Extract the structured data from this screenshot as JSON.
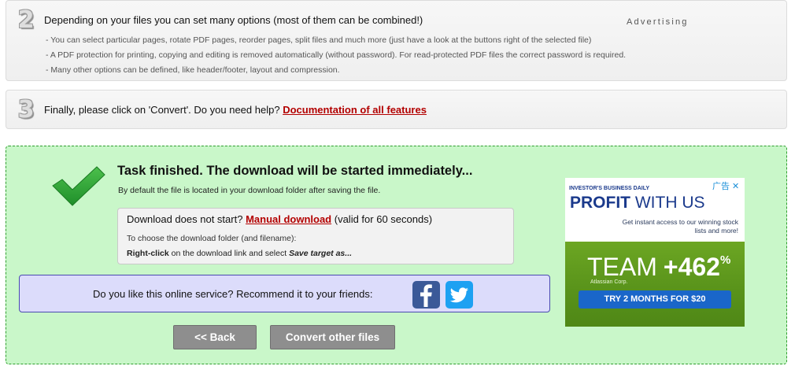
{
  "step2": {
    "number": "2",
    "title": "Depending on your files you can set many options (most of them can be combined!)",
    "notes": [
      "- You can select particular pages, rotate PDF pages, reorder pages, split files and much more (just have a look at the buttons right of the selected file)",
      "- A PDF protection for printing, copying and editing is removed automatically (without password). For read-protected PDF files the correct password is required.",
      "- Many other options can be defined, like header/footer, layout and compression."
    ]
  },
  "step3": {
    "number": "3",
    "text": "Finally, please click on 'Convert'. Do you need help?",
    "link": "Documentation of all features"
  },
  "result": {
    "title": "Task finished. The download will be started immediately...",
    "subtitle": "By default the file is located in your download folder after saving the file.",
    "download": {
      "prefix": "Download does not start?",
      "link": "Manual download",
      "suffix": "(valid for 60 seconds)",
      "hint": "To choose the download folder (and filename):",
      "instruction_bold": "Right-click",
      "instruction_mid": "on the download link and select",
      "instruction_italic": "Save target as..."
    },
    "share": {
      "text": "Do you like this online service? Recommend it to your friends:",
      "facebook_icon": "facebook-icon",
      "twitter_icon": "twitter-icon"
    },
    "buttons": {
      "back": "<< Back",
      "convert_other": "Convert other files"
    }
  },
  "ad": {
    "label": "Advertising",
    "publisher": "INVESTOR'S BUSINESS DAILY",
    "close": "广告 ✕",
    "headline_bold": "PROFIT",
    "headline_rest": "WITH US",
    "body": "Get instant access to our winning stock lists and more!",
    "team": "TEAM",
    "percent": "+462",
    "percent_sign": "%",
    "company": "Atlassian Corp.",
    "cta": "TRY 2 MONTHS FOR $20"
  },
  "colors": {
    "result_bg": "#c9f7c9",
    "result_border": "#2f9e2f",
    "link": "#b30000",
    "share_bg": "#dcdcfb",
    "button_bg": "#8e8e8e",
    "ad_green": "#6ca623",
    "ad_blue": "#1a66c9"
  }
}
